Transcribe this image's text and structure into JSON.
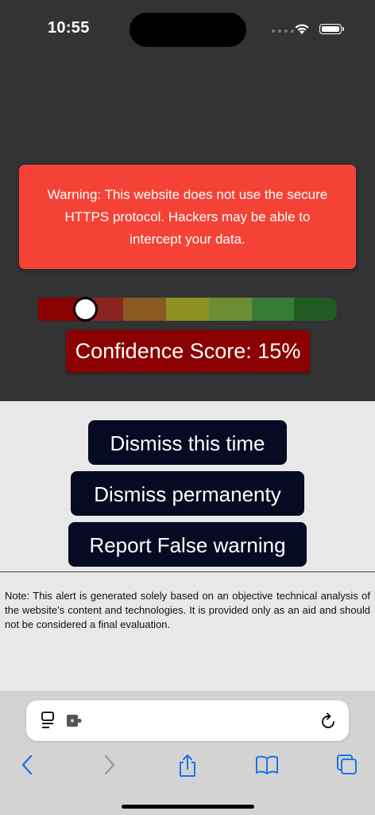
{
  "status_bar": {
    "time": "10:55"
  },
  "alert": {
    "message": "Warning: This website does not use the secure HTTPS protocol. Hackers may be able to intercept your data.",
    "confidence_label": "Confidence Score: 15%",
    "confidence_value": 0.15,
    "scale_colors": [
      "#8b0000",
      "#8a2422",
      "#8b5a22",
      "#8e9122",
      "#6c8d34",
      "#377b36",
      "#215b23"
    ]
  },
  "actions": {
    "dismiss_once": "Dismiss this time",
    "dismiss_permanent": "Dismiss permanenty",
    "report": "Report False warning"
  },
  "note": "Note: This alert is generated solely based on an objective technical analysis of the website’s content and technologies. It is provided only as an aid and should not be considered a final evaluation.",
  "colors": {
    "warning_bg": "#f44336",
    "score_bg": "#8b0000",
    "button_bg": "#060a22",
    "link_blue": "#1a73e8"
  },
  "browser": {
    "icons": [
      "reader-icon",
      "extension-icon",
      "reload-icon",
      "back-icon",
      "forward-icon",
      "share-icon",
      "bookmarks-icon",
      "tabs-icon"
    ]
  }
}
